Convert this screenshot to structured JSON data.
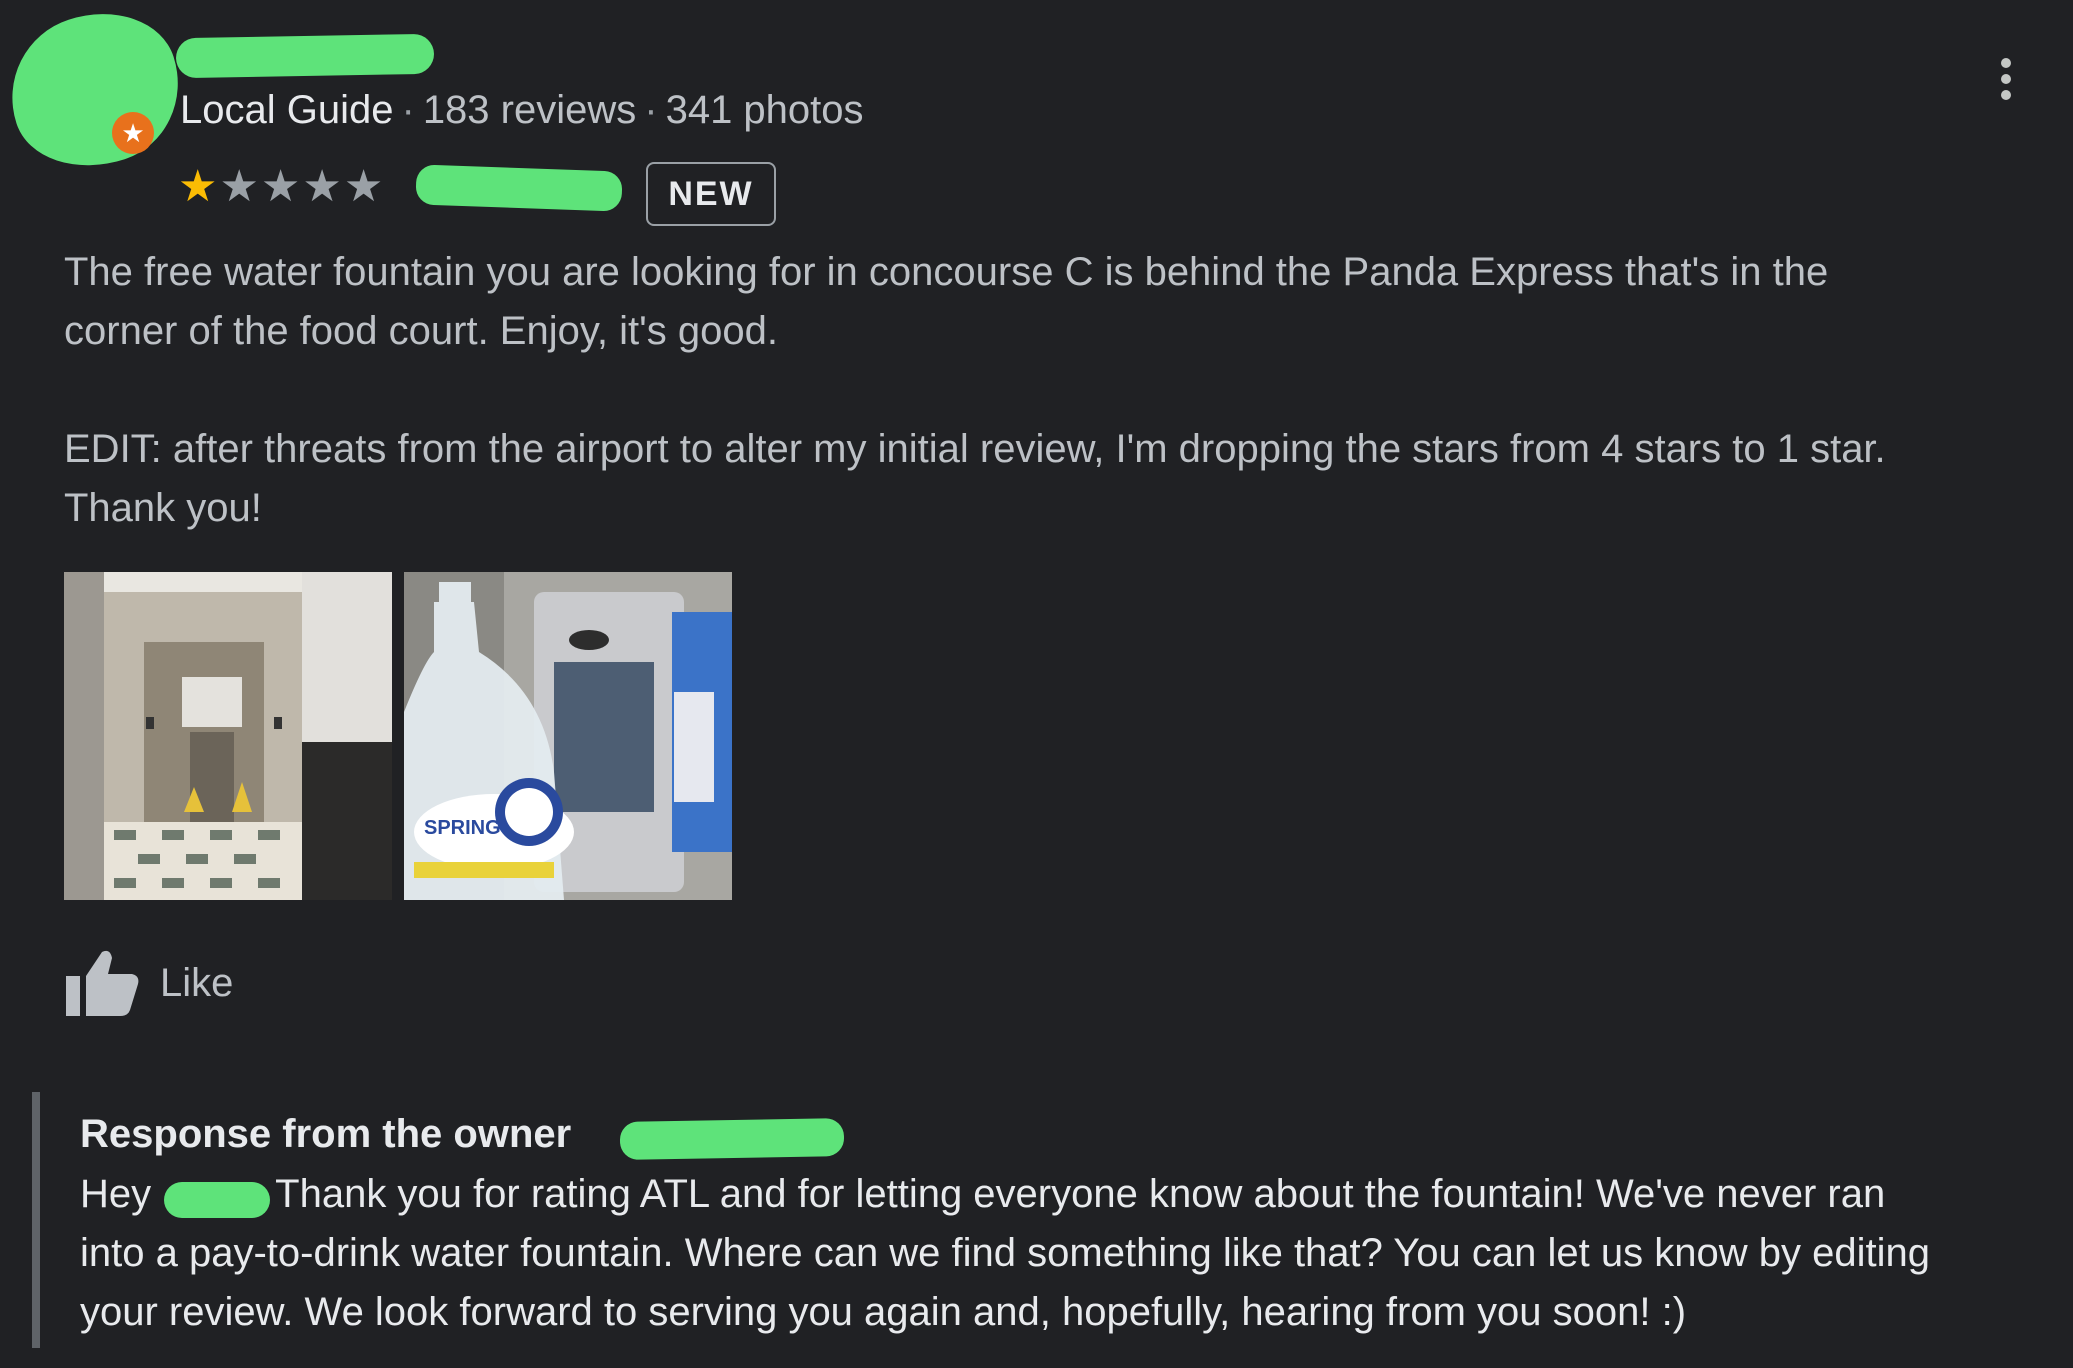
{
  "reviewer": {
    "badge": "Local Guide",
    "reviews": "183 reviews",
    "photos": "341 photos",
    "separator": "·"
  },
  "rating": {
    "value": 1,
    "max": 5,
    "star_on_color": "#fbbc04",
    "star_off_color": "#9aa0a6"
  },
  "new_badge": "NEW",
  "review": {
    "lines": [
      "The free water fountain you are looking for in concourse C is behind the Panda Express that's in the",
      "corner of the food court. Enjoy, it's good.",
      "EDIT: after threats from the airport to alter my initial review, I'm dropping the stars from 4 stars to 1 star.",
      "Thank you!"
    ]
  },
  "photos": [
    {
      "icon": "photo-restroom-hallway"
    },
    {
      "icon": "photo-water-bottle-fountain",
      "bottle_label": "SPRING"
    }
  ],
  "like": {
    "label": "Like",
    "icon": "thumbs-up-icon"
  },
  "owner_response": {
    "title": "Response from the owner",
    "lines": [
      "Hey",
      "Thank you for rating ATL and for letting everyone know about the fountain! We've never ran",
      "into a pay-to-drink water fountain. Where can we find something like that? You can let us know by editing",
      "your review. We look forward to serving you again and, hopefully, hearing from you soon! :)"
    ]
  },
  "colors": {
    "background": "#202124",
    "redaction": "#5ee37a",
    "text_primary": "#e8eaed",
    "text_secondary": "#bdc1c6"
  }
}
